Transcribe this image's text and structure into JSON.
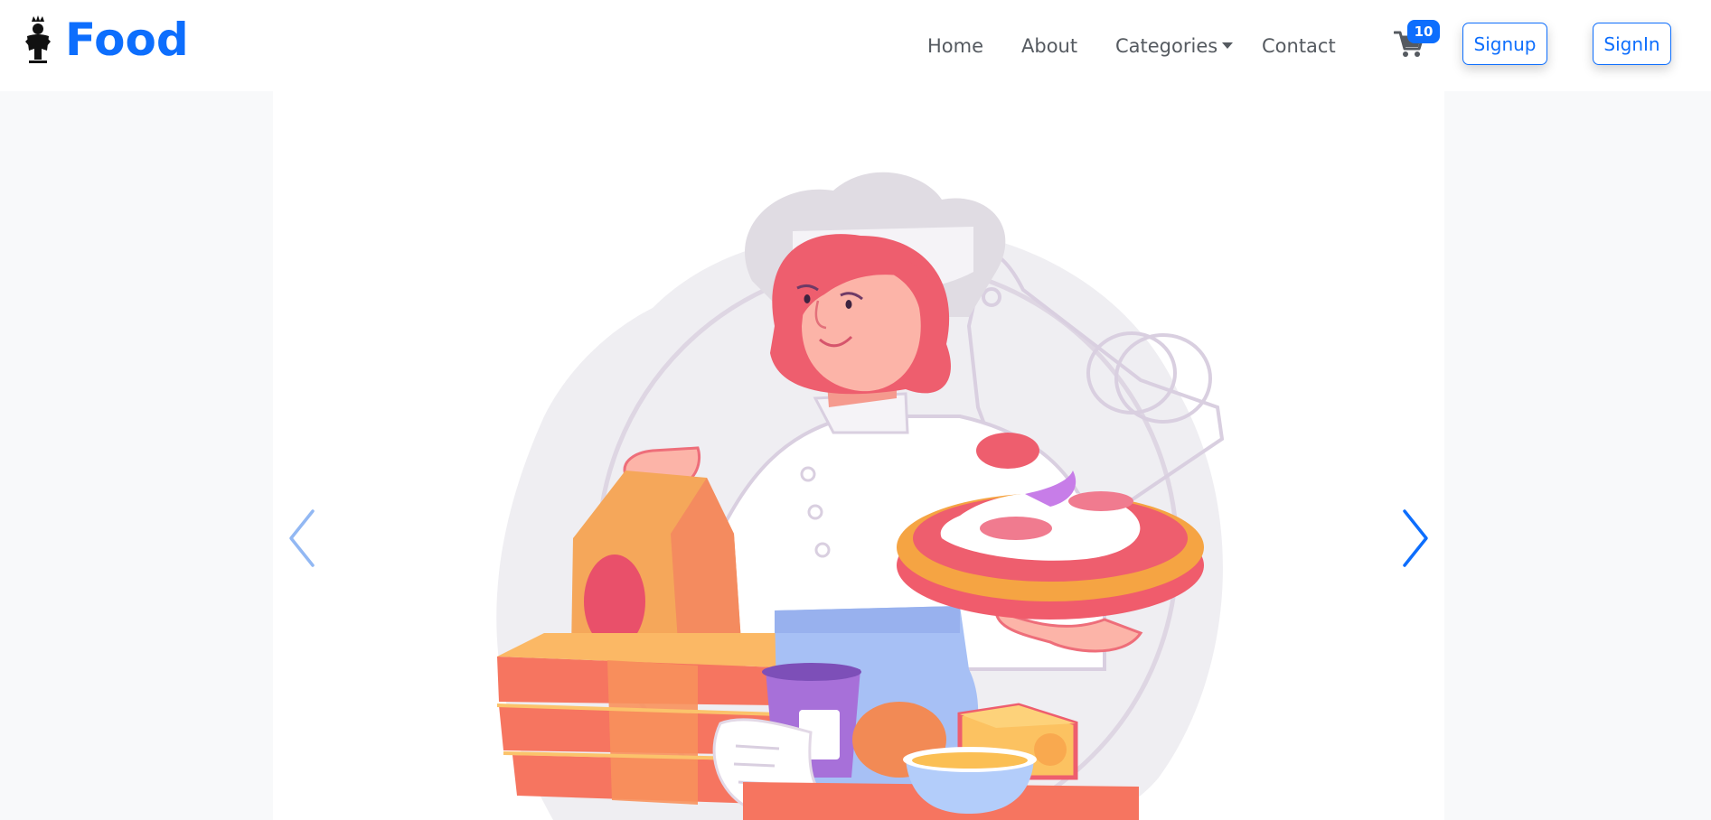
{
  "brand": {
    "name": "Food",
    "logo_icon": "crowned-figure-icon"
  },
  "nav": {
    "links": [
      {
        "label": "Home"
      },
      {
        "label": "About"
      },
      {
        "label": "Categories"
      },
      {
        "label": "Contact"
      }
    ],
    "cart": {
      "icon": "cart-icon",
      "count": "10"
    },
    "buttons": {
      "signup": "Signup",
      "signin": "SignIn"
    }
  },
  "carousel": {
    "slide_image": "chef-with-pizza-illustration",
    "prev_icon": "chevron-left-icon",
    "next_icon": "chevron-right-icon"
  },
  "colors": {
    "primary": "#0d6efd",
    "nav_text": "#555a60",
    "page_bg": "#f8f9fa",
    "hair": "#ee5e6e",
    "pizza_crust": "#f5a443"
  }
}
